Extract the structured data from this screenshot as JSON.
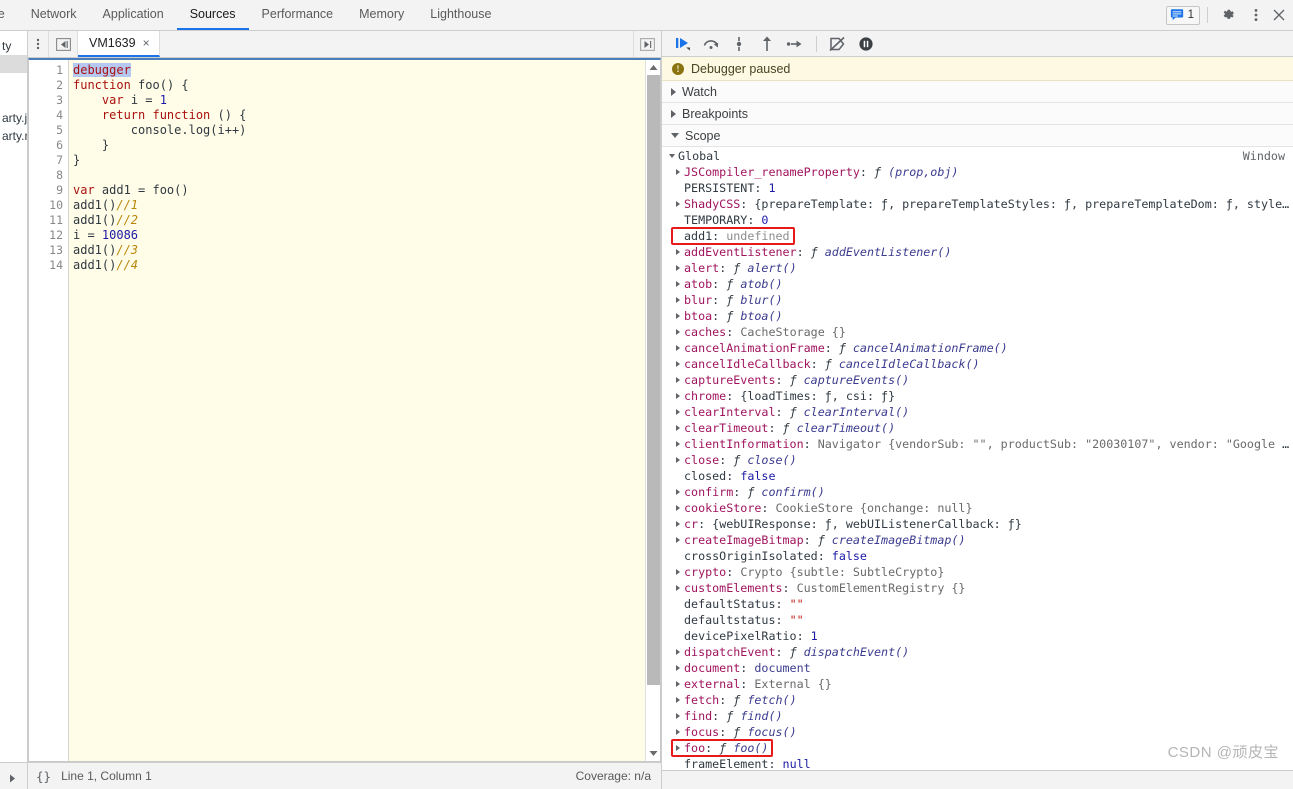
{
  "devtools": {
    "top_tabs": [
      {
        "label": "ole",
        "active": false,
        "clipped": true
      },
      {
        "label": "Network",
        "active": false
      },
      {
        "label": "Application",
        "active": false
      },
      {
        "label": "Sources",
        "active": true
      },
      {
        "label": "Performance",
        "active": false
      },
      {
        "label": "Memory",
        "active": false
      },
      {
        "label": "Lighthouse",
        "active": false
      }
    ],
    "message_count": "1",
    "icons": {
      "messages": "message-icon",
      "settings": "gear-icon",
      "more": "kebab-menu-icon",
      "close": "close-icon"
    }
  },
  "navigator": {
    "rows": [
      {
        "label": "ty",
        "selected": false
      },
      {
        "label": "",
        "selected": true
      },
      {
        "label": "",
        "selected": false
      },
      {
        "label": "",
        "selected": false
      },
      {
        "label": "arty.j",
        "selected": false
      },
      {
        "label": "arty.n",
        "selected": false
      }
    ]
  },
  "file_tabs": {
    "kebab": "kebab-menu-icon",
    "panel_toggle": "show-navigator-icon",
    "tabs": [
      {
        "label": "VM1639",
        "active": true,
        "close": "×"
      }
    ],
    "more_tabs": "more-tabs-icon"
  },
  "editor": {
    "lines": [
      {
        "n": "1",
        "highlighted": true,
        "tokens": [
          {
            "t": "debugger",
            "c": "tk-kw",
            "sel": true
          }
        ]
      },
      {
        "n": "2",
        "tokens": [
          {
            "t": "function ",
            "c": "tk-kw"
          },
          {
            "t": "foo",
            "c": "tk-id"
          },
          {
            "t": "() {",
            "c": "tk-id"
          }
        ]
      },
      {
        "n": "3",
        "tokens": [
          {
            "t": "    ",
            "c": "tk-id"
          },
          {
            "t": "var ",
            "c": "tk-kw"
          },
          {
            "t": "i = ",
            "c": "tk-id"
          },
          {
            "t": "1",
            "c": "tk-num"
          }
        ]
      },
      {
        "n": "4",
        "tokens": [
          {
            "t": "    ",
            "c": "tk-id"
          },
          {
            "t": "return function ",
            "c": "tk-kw"
          },
          {
            "t": "() {",
            "c": "tk-id"
          }
        ]
      },
      {
        "n": "5",
        "tokens": [
          {
            "t": "        console.",
            "c": "tk-id"
          },
          {
            "t": "log",
            "c": "tk-id"
          },
          {
            "t": "(i++)",
            "c": "tk-id"
          }
        ]
      },
      {
        "n": "6",
        "tokens": [
          {
            "t": "    }",
            "c": "tk-id"
          }
        ]
      },
      {
        "n": "7",
        "tokens": [
          {
            "t": "}",
            "c": "tk-id"
          }
        ]
      },
      {
        "n": "8",
        "tokens": [
          {
            "t": "",
            "c": "tk-id"
          }
        ]
      },
      {
        "n": "9",
        "tokens": [
          {
            "t": "var ",
            "c": "tk-kw"
          },
          {
            "t": "add1 = ",
            "c": "tk-id"
          },
          {
            "t": "foo",
            "c": "tk-id"
          },
          {
            "t": "()",
            "c": "tk-id"
          }
        ]
      },
      {
        "n": "10",
        "tokens": [
          {
            "t": "add1",
            "c": "tk-id"
          },
          {
            "t": "()",
            "c": "tk-id"
          },
          {
            "t": "//1",
            "c": "tk-cmt"
          }
        ]
      },
      {
        "n": "11",
        "tokens": [
          {
            "t": "add1",
            "c": "tk-id"
          },
          {
            "t": "()",
            "c": "tk-id"
          },
          {
            "t": "//2",
            "c": "tk-cmt"
          }
        ]
      },
      {
        "n": "12",
        "tokens": [
          {
            "t": "i = ",
            "c": "tk-id"
          },
          {
            "t": "10086",
            "c": "tk-num"
          }
        ]
      },
      {
        "n": "13",
        "tokens": [
          {
            "t": "add1",
            "c": "tk-id"
          },
          {
            "t": "()",
            "c": "tk-id"
          },
          {
            "t": "//3",
            "c": "tk-cmt"
          }
        ]
      },
      {
        "n": "14",
        "tokens": [
          {
            "t": "add1",
            "c": "tk-id"
          },
          {
            "t": "()",
            "c": "tk-id"
          },
          {
            "t": "//4",
            "c": "tk-cmt"
          }
        ]
      }
    ],
    "status": {
      "format_icon": "{}",
      "position": "Line 1, Column 1",
      "coverage": "Coverage: n/a"
    }
  },
  "debugger": {
    "toolbar": [
      {
        "name": "resume-button",
        "title": "Resume script execution"
      },
      {
        "name": "step-over-button",
        "title": "Step over next function call"
      },
      {
        "name": "step-into-button",
        "title": "Step into next function call"
      },
      {
        "name": "step-out-button",
        "title": "Step out of current function"
      },
      {
        "name": "step-button",
        "title": "Step"
      },
      {
        "name": "deactivate-breakpoints-button",
        "title": "Deactivate breakpoints"
      },
      {
        "name": "pause-on-exceptions-button",
        "title": "Pause on exceptions"
      }
    ],
    "paused_message": "Debugger paused",
    "sections": [
      {
        "label": "Watch",
        "expanded": false
      },
      {
        "label": "Breakpoints",
        "expanded": false
      },
      {
        "label": "Scope",
        "expanded": true
      }
    ],
    "scope": {
      "root": {
        "label": "Global",
        "type": "Window",
        "expanded": true
      },
      "entries": [
        {
          "tw": true,
          "name": "JSCompiler_renameProperty",
          "sep": ": ",
          "fn": true,
          "value": "(prop,obj)",
          "vclass": "v-fn"
        },
        {
          "tw": false,
          "name": "PERSISTENT",
          "sep": ": ",
          "value": "1",
          "vclass": "v-num",
          "plain": true
        },
        {
          "tw": true,
          "name": "ShadyCSS",
          "sep": ": ",
          "value": "{prepareTemplate: ƒ, prepareTemplateStyles: ƒ, prepareTemplateDom: ƒ, styleSubt…",
          "vclass": "v-obj"
        },
        {
          "tw": false,
          "name": "TEMPORARY",
          "sep": ": ",
          "value": "0",
          "vclass": "v-num",
          "plain": true
        },
        {
          "tw": false,
          "name": "add1",
          "sep": ": ",
          "value": "undefined",
          "vclass": "v-undef",
          "plain": true,
          "highlight": "box1"
        },
        {
          "tw": true,
          "name": "addEventListener",
          "sep": ": ",
          "fn": true,
          "value": "addEventListener()",
          "vclass": "v-fn"
        },
        {
          "tw": true,
          "name": "alert",
          "sep": ": ",
          "fn": true,
          "value": "alert()",
          "vclass": "v-fn"
        },
        {
          "tw": true,
          "name": "atob",
          "sep": ": ",
          "fn": true,
          "value": "atob()",
          "vclass": "v-fn"
        },
        {
          "tw": true,
          "name": "blur",
          "sep": ": ",
          "fn": true,
          "value": "blur()",
          "vclass": "v-fn"
        },
        {
          "tw": true,
          "name": "btoa",
          "sep": ": ",
          "fn": true,
          "value": "btoa()",
          "vclass": "v-fn"
        },
        {
          "tw": true,
          "name": "caches",
          "sep": ": ",
          "value": "CacheStorage {}",
          "vclass": "v-cls"
        },
        {
          "tw": true,
          "name": "cancelAnimationFrame",
          "sep": ": ",
          "fn": true,
          "value": "cancelAnimationFrame()",
          "vclass": "v-fn"
        },
        {
          "tw": true,
          "name": "cancelIdleCallback",
          "sep": ": ",
          "fn": true,
          "value": "cancelIdleCallback()",
          "vclass": "v-fn"
        },
        {
          "tw": true,
          "name": "captureEvents",
          "sep": ": ",
          "fn": true,
          "value": "captureEvents()",
          "vclass": "v-fn"
        },
        {
          "tw": true,
          "name": "chrome",
          "sep": ": ",
          "value": "{loadTimes: ƒ, csi: ƒ}",
          "vclass": "v-obj"
        },
        {
          "tw": true,
          "name": "clearInterval",
          "sep": ": ",
          "fn": true,
          "value": "clearInterval()",
          "vclass": "v-fn"
        },
        {
          "tw": true,
          "name": "clearTimeout",
          "sep": ": ",
          "fn": true,
          "value": "clearTimeout()",
          "vclass": "v-fn"
        },
        {
          "tw": true,
          "name": "clientInformation",
          "sep": ": ",
          "value": "Navigator {vendorSub: \"\", productSub: \"20030107\", vendor: \"Google Inc…",
          "vclass": "v-cls",
          "rich": "clientinfo"
        },
        {
          "tw": true,
          "name": "close",
          "sep": ": ",
          "fn": true,
          "value": "close()",
          "vclass": "v-fn"
        },
        {
          "tw": false,
          "name": "closed",
          "sep": ": ",
          "value": "false",
          "vclass": "v-kw",
          "plain": true
        },
        {
          "tw": true,
          "name": "confirm",
          "sep": ": ",
          "fn": true,
          "value": "confirm()",
          "vclass": "v-fn"
        },
        {
          "tw": true,
          "name": "cookieStore",
          "sep": ": ",
          "value": "CookieStore {onchange: null}",
          "vclass": "v-cls",
          "rich": "cookiestore"
        },
        {
          "tw": true,
          "name": "cr",
          "sep": ": ",
          "value": "{webUIResponse: ƒ, webUIListenerCallback: ƒ}",
          "vclass": "v-obj"
        },
        {
          "tw": true,
          "name": "createImageBitmap",
          "sep": ": ",
          "fn": true,
          "value": "createImageBitmap()",
          "vclass": "v-fn"
        },
        {
          "tw": false,
          "name": "crossOriginIsolated",
          "sep": ": ",
          "value": "false",
          "vclass": "v-kw",
          "plain": true
        },
        {
          "tw": true,
          "name": "crypto",
          "sep": ": ",
          "value": "Crypto {subtle: SubtleCrypto}",
          "vclass": "v-cls"
        },
        {
          "tw": true,
          "name": "customElements",
          "sep": ": ",
          "value": "CustomElementRegistry {}",
          "vclass": "v-cls"
        },
        {
          "tw": false,
          "name": "defaultStatus",
          "sep": ": ",
          "value": "\"\"",
          "vclass": "v-str",
          "plain": true
        },
        {
          "tw": false,
          "name": "defaultstatus",
          "sep": ": ",
          "value": "\"\"",
          "vclass": "v-str",
          "plain": true
        },
        {
          "tw": false,
          "name": "devicePixelRatio",
          "sep": ": ",
          "value": "1",
          "vclass": "v-num",
          "plain": true
        },
        {
          "tw": true,
          "name": "dispatchEvent",
          "sep": ": ",
          "fn": true,
          "value": "dispatchEvent()",
          "vclass": "v-fn"
        },
        {
          "tw": true,
          "name": "document",
          "sep": ": ",
          "value": "document",
          "vclass": "v-doc"
        },
        {
          "tw": true,
          "name": "external",
          "sep": ": ",
          "value": "External {}",
          "vclass": "v-cls"
        },
        {
          "tw": true,
          "name": "fetch",
          "sep": ": ",
          "fn": true,
          "value": "fetch()",
          "vclass": "v-fn"
        },
        {
          "tw": true,
          "name": "find",
          "sep": ": ",
          "fn": true,
          "value": "find()",
          "vclass": "v-fn"
        },
        {
          "tw": true,
          "name": "focus",
          "sep": ": ",
          "fn": true,
          "value": "focus()",
          "vclass": "v-fn"
        },
        {
          "tw": true,
          "name": "foo",
          "sep": ": ",
          "fn": true,
          "value": "foo()",
          "vclass": "v-fn",
          "highlight": "box2"
        },
        {
          "tw": false,
          "name": "frameElement",
          "sep": ": ",
          "value": "null",
          "vclass": "v-null",
          "plain": true
        }
      ]
    }
  },
  "watermark": "CSDN @顽皮宝",
  "colors": {
    "accent": "#1a73e8",
    "editor_bg": "#fffde7",
    "paused_bg": "#fdf9e2",
    "highlight_box": "#e8191a",
    "selection": "#b4c8f0"
  }
}
